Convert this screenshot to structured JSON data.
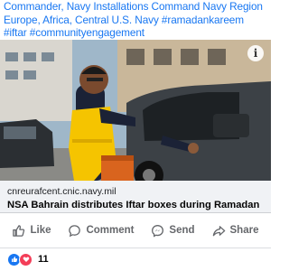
{
  "post": {
    "caption": "Commander, Navy Installations Command Navy Region Europe, Africa, Central U.S. Navy #ramadankareem #iftar #communityengagement",
    "link": {
      "domain": "cnreurafcent.cnic.navy.mil",
      "headline": "NSA Bahrain distributes Iftar boxes during Ramadan"
    },
    "info_icon": "i"
  },
  "actions": [
    {
      "label": "Like",
      "icon": "thumbs-up-icon"
    },
    {
      "label": "Comment",
      "icon": "comment-icon"
    },
    {
      "label": "Send",
      "icon": "messenger-icon"
    },
    {
      "label": "Share",
      "icon": "share-arrow-icon"
    }
  ],
  "reactions": {
    "types": [
      "like",
      "love"
    ],
    "count": "11"
  },
  "colors": {
    "accent": "#1877f2",
    "muted": "#65676b",
    "vest": "#f5c400",
    "love": "#f33e58"
  }
}
